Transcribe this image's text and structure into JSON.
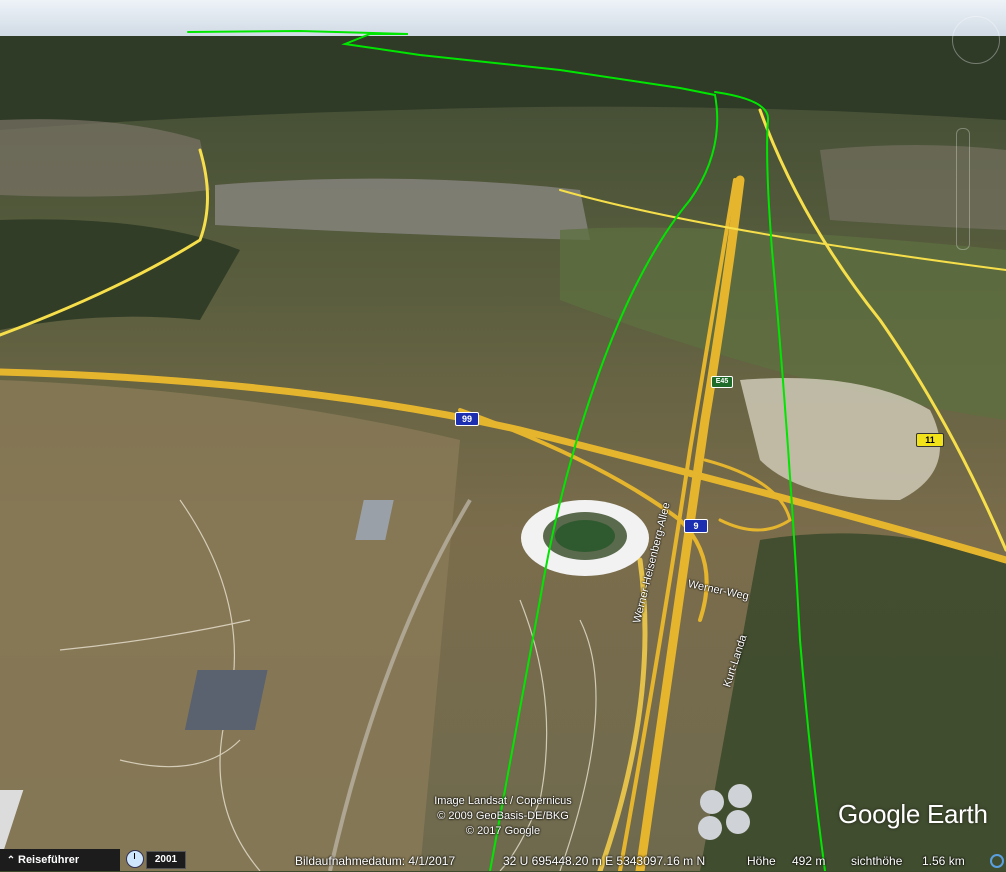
{
  "map": {
    "route_color": "#00e600",
    "road_color": "#f1c232"
  },
  "labels": {
    "shield_99": "99",
    "shield_9": "9",
    "shield_11": "11",
    "shield_e45": "E45",
    "street_heisenberg": "Werner-Heisenberg-Allee",
    "street_weg": "Werner-Weg",
    "street_kurt": "Kurt-Landa"
  },
  "attribution": {
    "line1": "Image Landsat / Copernicus",
    "line2": "© 2009 GeoBasis-DE/BKG",
    "line3": "© 2017 Google"
  },
  "logo": "Google Earth",
  "statusbar": {
    "tour_guide_label": "Reiseführer",
    "historical_year": "2001",
    "imagery_date": "Bildaufnahmedatum: 4/1/2017",
    "coordinates": "32 U 695448.20 m E 5343097.16 m N",
    "elevation_label": "Höhe",
    "elevation_value": "492 m",
    "eye_alt_label": "sichthöhe",
    "eye_alt_value": "1.56 km"
  }
}
